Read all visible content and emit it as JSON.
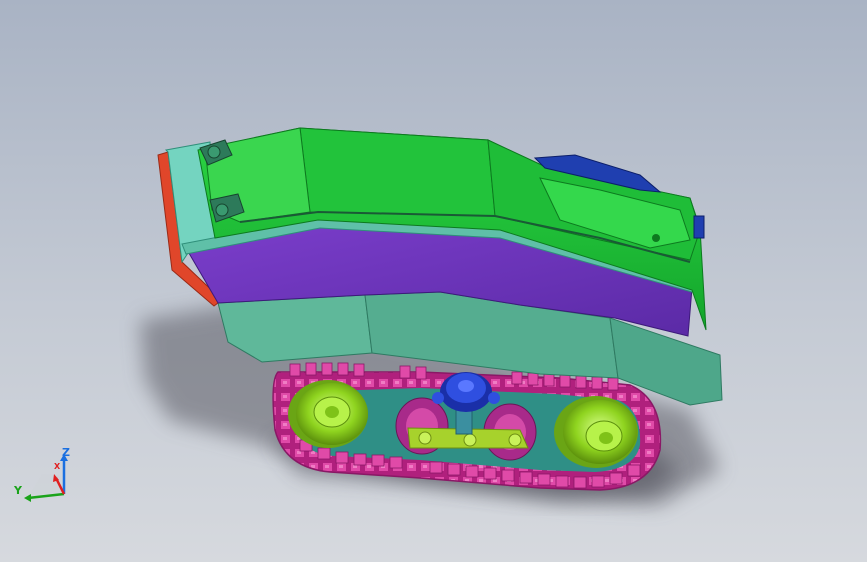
{
  "viewport": {
    "background_top": "#a9b3c4",
    "background_bottom": "#d6d9de"
  },
  "model": {
    "description_colors": {
      "hull_top": "#1fc43a",
      "hull_side": "#6a35b5",
      "fender": "#5fb89a",
      "track": "#d83c9c",
      "wheel": "#9be52c",
      "hub": "#2745d6",
      "front_plate": "#e0462a"
    }
  },
  "triad": {
    "z_label": "Z",
    "y_label": "Y",
    "x_label": "X",
    "z_color": "#1a6fe0",
    "y_color": "#1aa31a",
    "x_color": "#e02020"
  }
}
